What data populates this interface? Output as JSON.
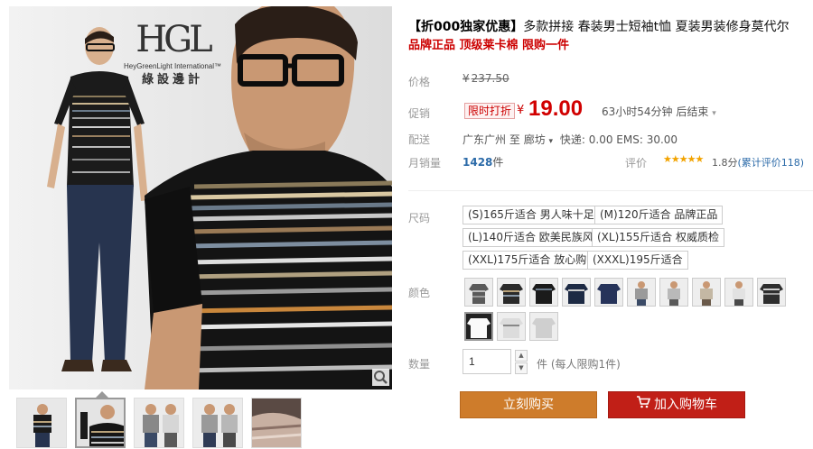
{
  "brand": {
    "logo_letters": "HGL",
    "logo_tagline": "HeyGreenLight International",
    "logo_cn": "綠設邊計",
    "trademark": "™"
  },
  "gallery": {
    "thumbnail_count": 5,
    "zoom_icon": "magnifier-icon"
  },
  "product": {
    "title_prefix": "【折000独家优惠】",
    "title_main": "多款拼接 春装男士短袖t恤 夏装男装修身莫代尔",
    "subtitle": "品牌正品 顶级莱卡棉 限购一件"
  },
  "labels": {
    "price": "价格",
    "promo": "促销",
    "shipping": "配送",
    "monthly_sales": "月销量",
    "rating": "评价",
    "size": "尺码",
    "color": "颜色",
    "quantity": "数量"
  },
  "price": {
    "currency": "¥",
    "original": "237.50",
    "promo_tag": "限时打折",
    "promo_value": "19.00",
    "countdown": "63小时54分钟 后结束",
    "countdown_caret": "▾"
  },
  "shipping": {
    "from": "广东广州",
    "to_label": "至",
    "to": "廊坊",
    "dropdown_caret": "▾",
    "fees": "快递: 0.00 EMS: 30.00"
  },
  "sales": {
    "count": "1428",
    "unit": "件"
  },
  "rating": {
    "stars": "★★★★★",
    "score": "1.8分",
    "count_text": "(累计评价118)"
  },
  "sizes": [
    "(S)165斤适合 男人味十足",
    "(M)120斤适合 品牌正品",
    "(L)140斤适合 欧美民族风",
    "(XL)155斤适合 权威质检",
    "(XXL)175斤适合 放心购",
    "(XXXL)195斤适合"
  ],
  "colors": {
    "swatch_count": 13,
    "accent": "#c00000"
  },
  "quantity": {
    "value": "1",
    "note": "件 (每人限购1件)",
    "up_icon": "▲",
    "down_icon": "▼"
  },
  "actions": {
    "buy_now": "立刻购买",
    "add_to_cart": "加入购物车",
    "buy_color": "#ce7c2b",
    "cart_color": "#c11f17"
  }
}
